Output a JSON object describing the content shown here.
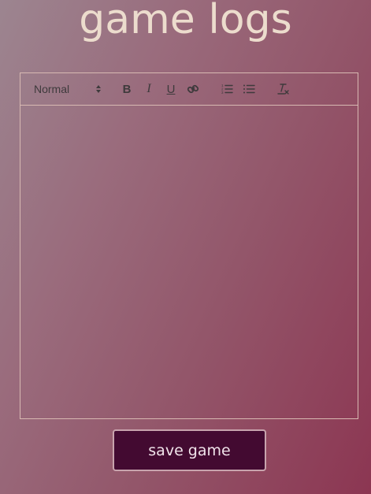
{
  "page": {
    "title": "game logs"
  },
  "editor": {
    "toolbar": {
      "header_select_value": "Normal",
      "bold_label": "B",
      "italic_label": "I",
      "underline_label": "U",
      "link_icon": "link-icon",
      "ordered_list_icon": "ordered-list-icon",
      "bullet_list_icon": "bullet-list-icon",
      "clean_icon": "clear-formatting-icon"
    },
    "content": ""
  },
  "actions": {
    "save_label": "save game"
  },
  "colors": {
    "title": "#ecdccd",
    "button_bg": "#430a31",
    "button_text": "#f0e3ea",
    "editor_border": "#d8b9b2",
    "toolbar_icon": "#3e3a3c",
    "background_start": "#9c8590",
    "background_end": "#8c3652"
  }
}
